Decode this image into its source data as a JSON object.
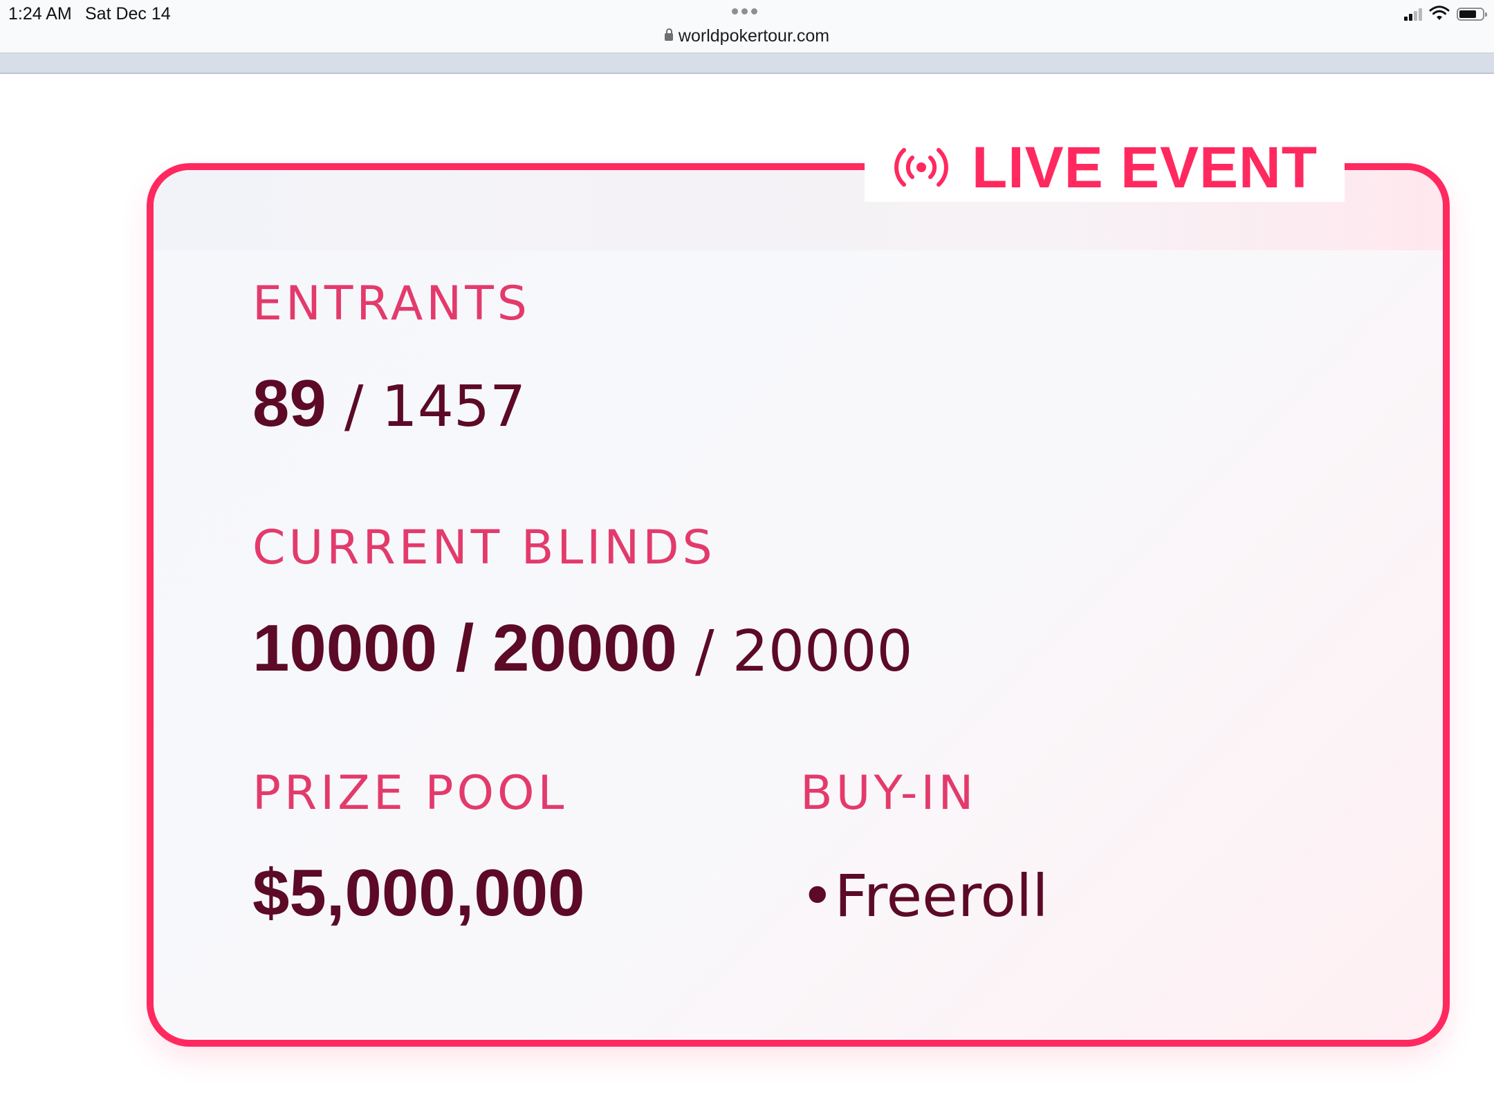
{
  "status_bar": {
    "time": "1:24 AM",
    "date": "Sat Dec 14"
  },
  "browser": {
    "url": "worldpokertour.com"
  },
  "card": {
    "badge_label": "LIVE EVENT",
    "entrants": {
      "label": "ENTRANTS",
      "current": "89",
      "separator": " / ",
      "max": "1457"
    },
    "blinds": {
      "label": "CURRENT BLINDS",
      "small_big": "10000 / 20000",
      "separator": " / ",
      "ante": "20000"
    },
    "prize_pool": {
      "label": "PRIZE POOL",
      "value": "$5,000,000"
    },
    "buy_in": {
      "label": "BUY-IN",
      "value": "•Freeroll"
    }
  },
  "colors": {
    "accent": "#ff2960",
    "label": "#e33a6c",
    "value": "#5c0a26"
  }
}
